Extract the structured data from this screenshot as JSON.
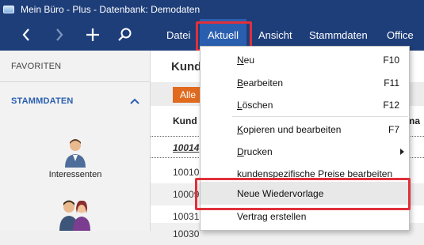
{
  "window": {
    "title": "Mein Büro - Plus - Datenbank: Demodaten"
  },
  "toolbar": {
    "back_icon": "chevron-left-icon",
    "forward_icon": "chevron-right-icon",
    "add_icon": "plus-icon",
    "search_icon": "search-icon",
    "tabs": [
      "Datei",
      "Aktuell",
      "Ansicht",
      "Stammdaten",
      "Office"
    ],
    "active_tab": "Aktuell"
  },
  "sidebar": {
    "favorites": "FAVORITEN",
    "stammdaten": "STAMMDATEN",
    "item_label": "Interessenten"
  },
  "main": {
    "title": "Kund",
    "filter": "Alle",
    "col_head": "Kund",
    "col_head2": "rma",
    "rows": [
      "10014",
      "10010",
      "10009",
      "10031",
      "10030"
    ]
  },
  "dropdown": {
    "items": [
      {
        "label": "Neu",
        "mnemonic": "N",
        "rest": "eu",
        "shortcut": "F10"
      },
      {
        "label": "Bearbeiten",
        "mnemonic": "B",
        "rest": "earbeiten",
        "shortcut": "F11"
      },
      {
        "label": "Löschen",
        "mnemonic": "L",
        "rest": "öschen",
        "shortcut": "F12"
      },
      {
        "label": "Kopieren und bearbeiten",
        "mnemonic": "K",
        "rest": "opieren und bearbeiten",
        "shortcut": "F7"
      },
      {
        "label": "Drucken",
        "mnemonic": "D",
        "rest": "rucken",
        "shortcut": ""
      },
      {
        "label": "kundenspezifische Preise bearbeiten",
        "mnemonic": "",
        "rest": "kundenspezifische Preise bearbeiten",
        "shortcut": ""
      },
      {
        "label": "Neue Wiedervorlage",
        "mnemonic": "",
        "rest": "Neue Wiedervorlage",
        "shortcut": ""
      },
      {
        "label": "Vertrag erstellen",
        "mnemonic": "",
        "rest": "Vertrag erstellen",
        "shortcut": ""
      }
    ]
  },
  "colors": {
    "titlebar": "#1e3e7a",
    "accent": "#2a5fb0",
    "highlight": "#e0303a",
    "filter": "#e06b1f"
  }
}
